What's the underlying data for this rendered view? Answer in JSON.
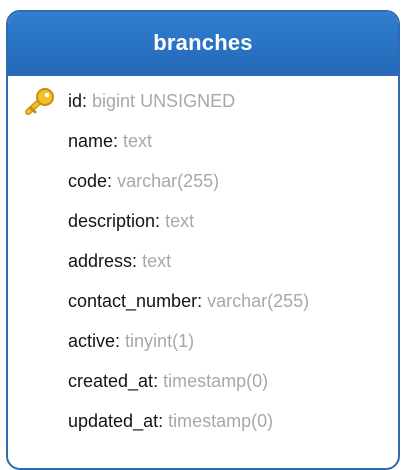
{
  "table": {
    "name": "branches",
    "fields": [
      {
        "name": "id",
        "type": "bigint UNSIGNED",
        "primary_key": true
      },
      {
        "name": "name",
        "type": "text"
      },
      {
        "name": "code",
        "type": "varchar(255)"
      },
      {
        "name": "description",
        "type": "text"
      },
      {
        "name": "address",
        "type": "text"
      },
      {
        "name": "contact_number",
        "type": "varchar(255)"
      },
      {
        "name": "active",
        "type": "tinyint(1)"
      },
      {
        "name": "created_at",
        "type": "timestamp(0)"
      },
      {
        "name": "updated_at",
        "type": "timestamp(0)"
      }
    ],
    "separator": ":",
    "icons": {
      "primary_key": "key-icon"
    },
    "colors": {
      "header": "#2a72c3",
      "border": "#2f6bb3",
      "field_name": "#141414",
      "field_type": "#a8a8a8",
      "key": "#e8b21a"
    }
  }
}
